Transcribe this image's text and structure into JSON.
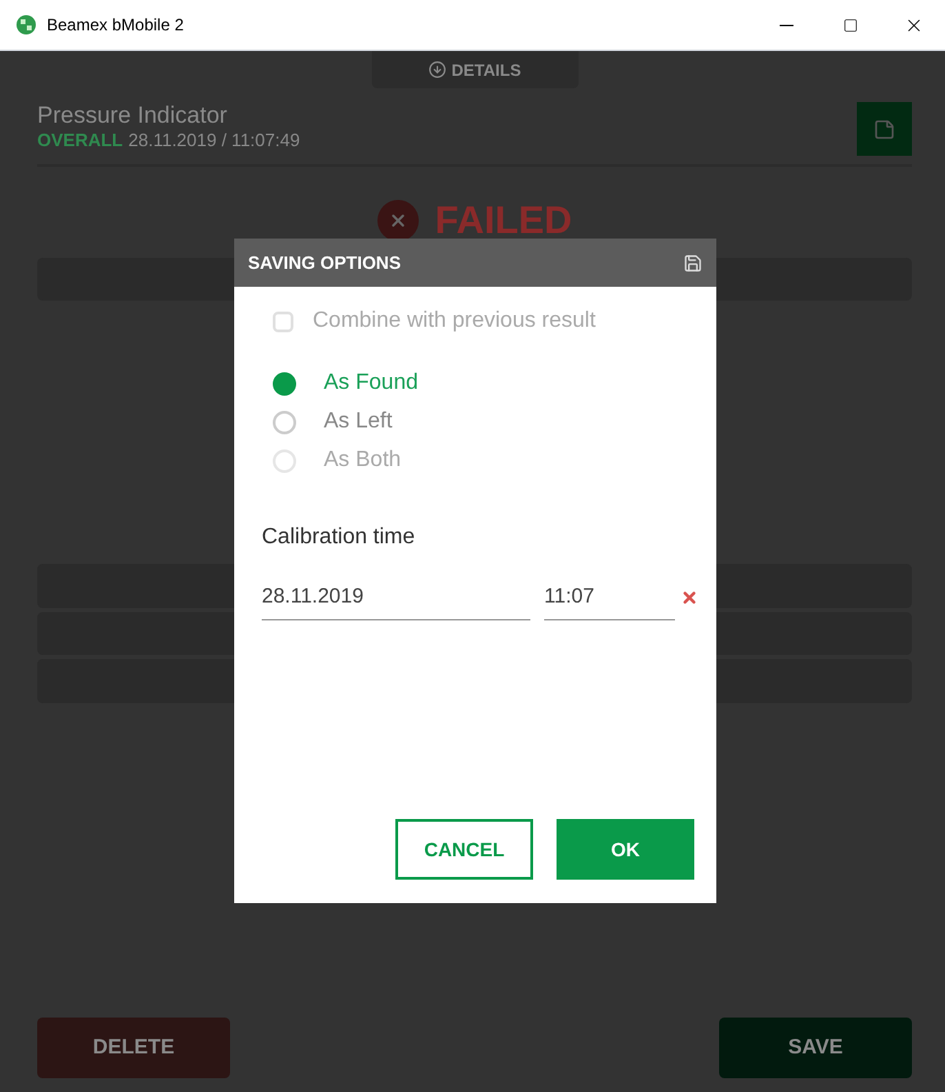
{
  "window": {
    "title": "Beamex bMobile 2"
  },
  "details_tab": {
    "label": "DETAILS"
  },
  "header": {
    "title": "Pressure Indicator",
    "overall_label": "OVERALL",
    "timestamp": "28.11.2019 / 11:07:49"
  },
  "result": {
    "status": "FAILED"
  },
  "dialog": {
    "title": "SAVING OPTIONS",
    "combine": {
      "label": "Combine with previous result",
      "checked": false,
      "disabled": true
    },
    "options": [
      {
        "label": "As Found",
        "selected": true,
        "disabled": false
      },
      {
        "label": "As Left",
        "selected": false,
        "disabled": false
      },
      {
        "label": "As Both",
        "selected": false,
        "disabled": true
      }
    ],
    "calibration_time_label": "Calibration time",
    "date": "28.11.2019",
    "time": "11:07",
    "buttons": [
      {
        "label": "CANCEL",
        "kind": "secondary"
      },
      {
        "label": "OK",
        "kind": "primary"
      }
    ]
  },
  "footer": {
    "buttons": [
      {
        "label": "DELETE",
        "kind": "danger"
      },
      {
        "label": "SAVE",
        "kind": "primary"
      }
    ]
  }
}
